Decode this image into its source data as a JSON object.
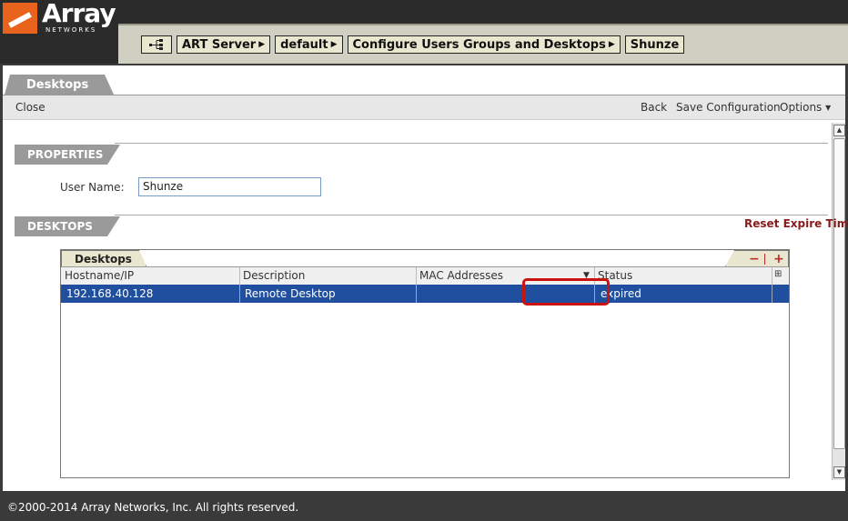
{
  "brand": {
    "name": "Array",
    "subtitle": "NETWORKS"
  },
  "breadcrumb": {
    "items": [
      "ART Server",
      "default",
      "Configure Users Groups and Desktops",
      "Shunze"
    ]
  },
  "page_tab": "Desktops",
  "toolbar": {
    "close": "Close",
    "back": "Back",
    "save": "Save Configuration",
    "options": "Options ▾"
  },
  "properties": {
    "section_title": "PROPERTIES",
    "username_label": "User Name:",
    "username_value": "Shunze"
  },
  "desktops": {
    "section_title": "DESKTOPS",
    "reset_link": "Reset Expire Tim",
    "grid_tab": "Desktops",
    "columns": [
      "Hostname/IP",
      "Description",
      "MAC Addresses",
      "Status"
    ],
    "rows": [
      {
        "hostname": "192.168.40.128",
        "description": "Remote Desktop",
        "mac": "",
        "status": "expired"
      }
    ]
  },
  "footer": "©2000-2014 Array Networks, Inc. All rights reserved.",
  "colors": {
    "accent": "#e8641c",
    "selected_row": "#1f4f9e",
    "highlight": "#cc1111",
    "link": "#8b1a1a"
  }
}
